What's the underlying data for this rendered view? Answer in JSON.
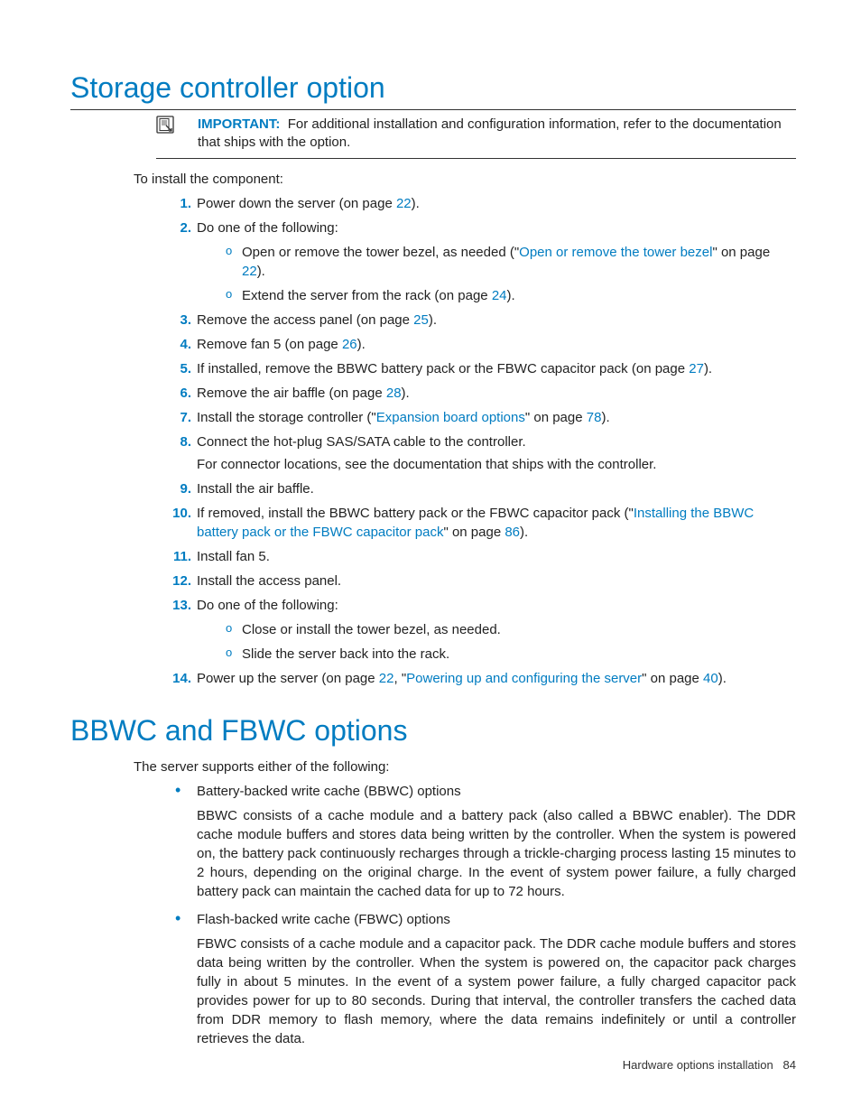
{
  "section1": {
    "title": "Storage controller option",
    "callout": {
      "label": "IMPORTANT:",
      "text": "For additional installation and configuration information, refer to the documentation that ships with the option."
    },
    "lead": "To install the component:",
    "steps": {
      "s1a": "Power down the server (on page ",
      "s1link": "22",
      "s1b": ").",
      "s2": "Do one of the following:",
      "s2a_a": "Open or remove the tower bezel, as needed (\"",
      "s2a_link": "Open or remove the tower bezel",
      "s2a_b": "\" on page ",
      "s2a_page": "22",
      "s2a_c": ").",
      "s2b_a": "Extend the server from the rack (on page ",
      "s2b_page": "24",
      "s2b_b": ").",
      "s3a": "Remove the access panel (on page ",
      "s3page": "25",
      "s3b": ").",
      "s4a": "Remove fan 5 (on page ",
      "s4page": "26",
      "s4b": ").",
      "s5a": "If installed, remove the BBWC battery pack or the FBWC capacitor pack (on page ",
      "s5page": "27",
      "s5b": ").",
      "s6a": "Remove the air baffle (on page ",
      "s6page": "28",
      "s6b": ").",
      "s7a": "Install the storage controller (\"",
      "s7link": "Expansion board options",
      "s7b": "\" on page ",
      "s7page": "78",
      "s7c": ").",
      "s8": "Connect the hot-plug SAS/SATA cable to the controller.",
      "s8note": "For connector locations, see the documentation that ships with the controller.",
      "s9": "Install the air baffle.",
      "s10a": "If removed, install the BBWC battery pack or the FBWC capacitor pack (\"",
      "s10link": "Installing the BBWC battery pack or the FBWC capacitor pack",
      "s10b": "\" on page ",
      "s10page": "86",
      "s10c": ").",
      "s11": "Install fan 5.",
      "s12": "Install the access panel.",
      "s13": "Do one of the following:",
      "s13a": "Close or install the tower bezel, as needed.",
      "s13b": "Slide the server back into the rack.",
      "s14a": "Power up the server (on page ",
      "s14page1": "22",
      "s14b": ", \"",
      "s14link": "Powering up and configuring the server",
      "s14c": "\" on page ",
      "s14page2": "40",
      "s14d": ")."
    }
  },
  "section2": {
    "title": "BBWC and FBWC options",
    "lead": "The server supports either of the following:",
    "bullets": [
      {
        "label": "Battery-backed write cache (BBWC) options",
        "desc": "BBWC consists of a cache module and a battery pack (also called a BBWC enabler). The DDR cache module buffers and stores data being written by the controller. When the system is powered on, the battery pack continuously recharges through a trickle-charging process lasting 15 minutes to 2 hours, depending on the original charge. In the event of system power failure, a fully charged battery pack can maintain the cached data for up to 72 hours."
      },
      {
        "label": "Flash-backed write cache (FBWC) options",
        "desc": "FBWC consists of a cache module and a capacitor pack. The DDR cache module buffers and stores data being written by the controller. When the system is powered on, the capacitor pack charges fully in about 5 minutes. In the event of a system power failure, a fully charged capacitor pack provides power for up to 80 seconds. During that interval, the controller transfers the cached data from DDR memory to flash memory, where the data remains indefinitely or until a controller retrieves the data."
      }
    ]
  },
  "footer": {
    "text": "Hardware options installation",
    "page": "84"
  }
}
